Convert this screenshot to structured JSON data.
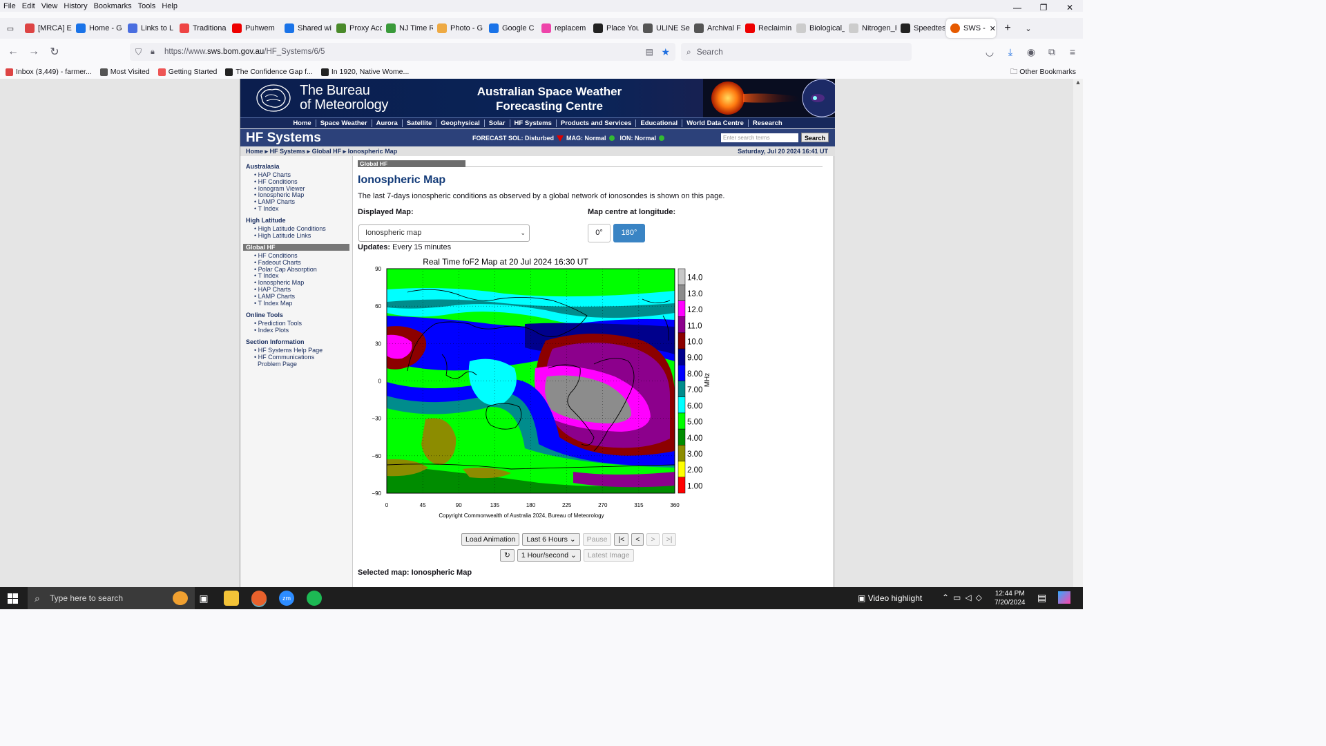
{
  "menubar": {
    "items": [
      "File",
      "Edit",
      "View",
      "History",
      "Bookmarks",
      "Tools",
      "Help"
    ]
  },
  "tabs": [
    {
      "label": "[MRCA] E",
      "color": "#d44"
    },
    {
      "label": "Home - G",
      "color": "#1a73e8"
    },
    {
      "label": "Links to L",
      "color": "#4a6ee0"
    },
    {
      "label": "Traditiona",
      "color": "#e44"
    },
    {
      "label": "Puhwem",
      "color": "#e00"
    },
    {
      "label": "Shared wi",
      "color": "#1a73e8"
    },
    {
      "label": "Proxy Acc",
      "color": "#4a8a2a"
    },
    {
      "label": "NJ Time R",
      "color": "#3a9a3a"
    },
    {
      "label": "Photo - G",
      "color": "#ea4"
    },
    {
      "label": "Google C",
      "color": "#1a73e8"
    },
    {
      "label": "replacem",
      "color": "#e4a"
    },
    {
      "label": "Place You",
      "color": "#222"
    },
    {
      "label": "ULINE Se",
      "color": "#555"
    },
    {
      "label": "Archival F",
      "color": "#555"
    },
    {
      "label": "Reclaimin",
      "color": "#e00"
    },
    {
      "label": "Biological_nit",
      "color": "#ccc"
    },
    {
      "label": "Nitrogen_Fixe",
      "color": "#ccc"
    },
    {
      "label": "Speedtes",
      "color": "#222"
    }
  ],
  "active_tab": {
    "label": "SWS -",
    "color": "#e65a00"
  },
  "nav": {
    "url_prefix": "https://www.",
    "url_domain": "sws.bom.gov.au",
    "url_path": "/HF_Systems/6/5",
    "search_placeholder": "Search"
  },
  "bookmarks": [
    {
      "label": "Inbox (3,449) - farmer...",
      "color": "#d44"
    },
    {
      "label": "Most Visited",
      "color": "#555"
    },
    {
      "label": "Getting Started",
      "color": "#e55"
    },
    {
      "label": "The Confidence Gap f...",
      "color": "#222"
    },
    {
      "label": "In 1920, Native Wome...",
      "color": "#222"
    }
  ],
  "other_bookmarks": "Other Bookmarks",
  "site": {
    "bom_title_line1": "The Bureau",
    "bom_title_line2": "of Meteorology",
    "sw_title_line1": "Australian Space Weather",
    "sw_title_line2": "Forecasting Centre",
    "topnav": [
      "Home",
      "Space Weather",
      "Aurora",
      "Satellite",
      "Geophysical",
      "Solar",
      "HF Systems",
      "Products and Services",
      "Educational",
      "World Data Centre",
      "Research"
    ],
    "section_title": "HF Systems",
    "forecast_label": "FORECAST",
    "sol": "SOL: Disturbed",
    "mag": "MAG: Normal",
    "ion": "ION: Normal",
    "search_placeholder": "Enter search terms",
    "search_button": "Search",
    "breadcrumb": "Home ▸ HF Systems ▸ Global HF ▸ Ionospheric Map",
    "date": "Saturday, Jul 20 2024 16:41 UT"
  },
  "leftnav": {
    "australasia": {
      "title": "Australasia",
      "items": [
        "HAP Charts",
        "HF Conditions",
        "Ionogram Viewer",
        "Ionospheric Map",
        "LAMP Charts",
        "T Index"
      ]
    },
    "highlat": {
      "title": "High Latitude",
      "items": [
        "High Latitude Conditions",
        "High Latitude Links"
      ]
    },
    "globalhf": {
      "title": "Global HF",
      "items": [
        "HF Conditions",
        "Fadeout Charts",
        "Polar Cap Absorption",
        "T Index",
        "Ionospheric Map",
        "HAP Charts",
        "LAMP Charts",
        "T Index Map"
      ]
    },
    "online": {
      "title": "Online Tools",
      "items": [
        "Prediction Tools",
        "Index Plots"
      ]
    },
    "section": {
      "title": "Section Information",
      "items": [
        "HF Systems Help Page",
        "HF Communications",
        "Problem Page"
      ]
    }
  },
  "main": {
    "tab_label": "Global HF",
    "title": "Ionospheric Map",
    "description": "The last 7-days ionospheric conditions as observed by a global network of ionosondes is shown on this page.",
    "displayed_map_label": "Displayed Map:",
    "map_select_value": "Ionospheric map",
    "map_centre_label": "Map centre at longitude:",
    "lon_btn_0": "0°",
    "lon_btn_180": "180°",
    "updates_label": "Updates:",
    "updates_value": " Every 15 minutes",
    "load_animation": "Load Animation",
    "last_hours": "Last 6 Hours",
    "pause": "Pause",
    "first": "|<",
    "prev": "<",
    "next": ">",
    "last": ">|",
    "refresh": "↻",
    "speed": "1 Hour/second",
    "latest_image": "Latest Image",
    "selected_map": "Selected map: Ionospheric Map"
  },
  "chart_data": {
    "type": "heatmap",
    "title": "Real Time foF2 Map at 20 Jul 2024 16:30 UT",
    "copyright": "Copyright Commonwealth of Australia 2024, Bureau of Meteorology",
    "x_ticks": [
      "0",
      "45",
      "90",
      "135",
      "180",
      "225",
      "270",
      "315",
      "360"
    ],
    "y_ticks": [
      "90",
      "60",
      "30",
      "0",
      "−30",
      "−60",
      "−90"
    ],
    "xlim": [
      0,
      360
    ],
    "ylim": [
      -90,
      90
    ],
    "colorbar_unit": "MHz",
    "colorbar": [
      {
        "value": "14.0",
        "color": "#c8c8c8"
      },
      {
        "value": "13.0",
        "color": "#8c8c8c"
      },
      {
        "value": "12.0",
        "color": "#ff00ff"
      },
      {
        "value": "11.0",
        "color": "#8c008c"
      },
      {
        "value": "10.0",
        "color": "#8c0000"
      },
      {
        "value": "9.00",
        "color": "#00008c"
      },
      {
        "value": "8.00",
        "color": "#0000ff"
      },
      {
        "value": "7.00",
        "color": "#008c8c"
      },
      {
        "value": "6.00",
        "color": "#00ffff"
      },
      {
        "value": "5.00",
        "color": "#00ff00"
      },
      {
        "value": "4.00",
        "color": "#008c00"
      },
      {
        "value": "3.00",
        "color": "#8c8c00"
      },
      {
        "value": "2.00",
        "color": "#ffff00"
      },
      {
        "value": "1.00",
        "color": "#ff0000"
      }
    ]
  },
  "taskbar": {
    "search": "Type here to search",
    "video_highlight": "Video highlight",
    "time": "12:44 PM",
    "date": "7/20/2024"
  }
}
